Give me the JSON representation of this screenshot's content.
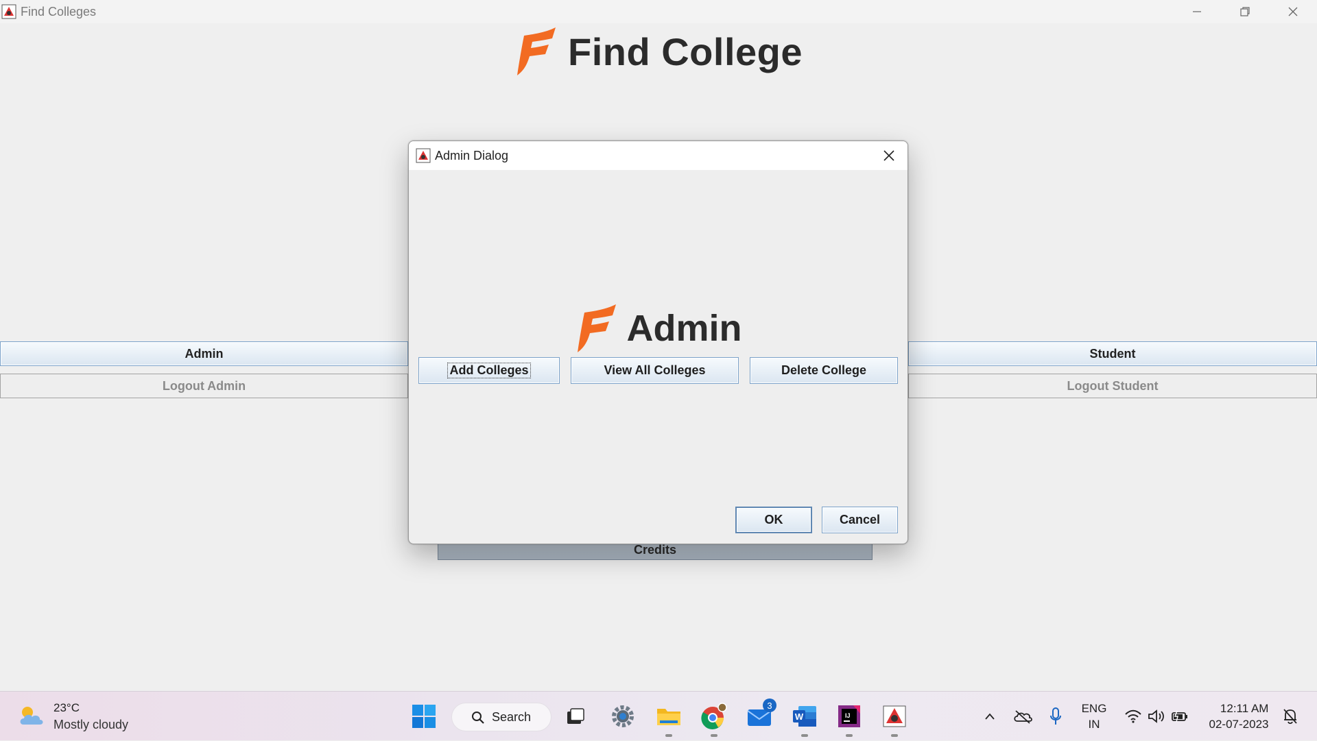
{
  "window": {
    "title": "Find Colleges",
    "heading": "Find College"
  },
  "main": {
    "admin_label": "Admin",
    "logout_admin_label": "Logout Admin",
    "student_label": "Student",
    "logout_student_label": "Logout Student",
    "credits_label": "Credits"
  },
  "dialog": {
    "title": "Admin Dialog",
    "heading": "Admin",
    "add_label": "Add Colleges",
    "view_label": "View All Colleges",
    "delete_label": "Delete College",
    "ok_label": "OK",
    "cancel_label": "Cancel"
  },
  "taskbar": {
    "weather_temp": "23°C",
    "weather_condition": "Mostly cloudy",
    "search_label": "Search",
    "mail_badge": "3",
    "lang_primary": "ENG",
    "lang_secondary": "IN",
    "time": "12:11 AM",
    "date": "02-07-2023"
  },
  "colors": {
    "logo_orange": "#f26b22",
    "button_border": "#7aa1c9",
    "credits_bg": "#afbac6"
  }
}
